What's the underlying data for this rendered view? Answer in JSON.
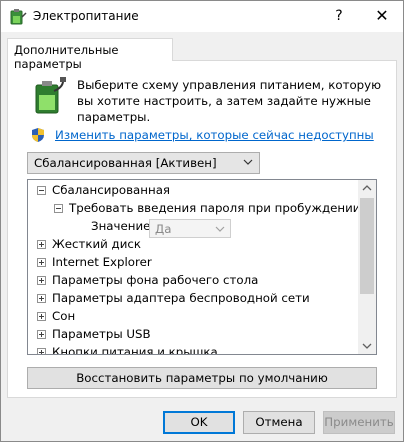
{
  "window": {
    "title": "Электропитание",
    "help_glyph": "?",
    "close_glyph": "✕"
  },
  "tab": {
    "label": "Дополнительные параметры"
  },
  "intro": {
    "icon": "battery-power-icon",
    "text": "Выберите схему управления питанием, которую вы хотите настроить, а затем задайте нужные параметры."
  },
  "link": {
    "icon": "uac-shield-icon",
    "text": "Изменить параметры, которые сейчас недоступны"
  },
  "scheme_select": {
    "value": "Сбалансированная [Активен]"
  },
  "tree": {
    "root": "Сбалансированная",
    "password_item": "Требовать введения пароля при пробуждении",
    "value_label": "Значение:",
    "value": "Да",
    "items": [
      "Жесткий диск",
      "Internet Explorer",
      "Параметры фона рабочего стола",
      "Параметры адаптера беспроводной сети",
      "Сон",
      "Параметры USB",
      "Кнопки питания и крышка"
    ]
  },
  "buttons": {
    "restore": "Восстановить параметры по умолчанию",
    "ok": "OK",
    "cancel": "Отмена",
    "apply": "Применить"
  },
  "colors": {
    "link": "#0066cc",
    "focus_border": "#0078d7",
    "dialog_bg": "#f0f0f0"
  }
}
